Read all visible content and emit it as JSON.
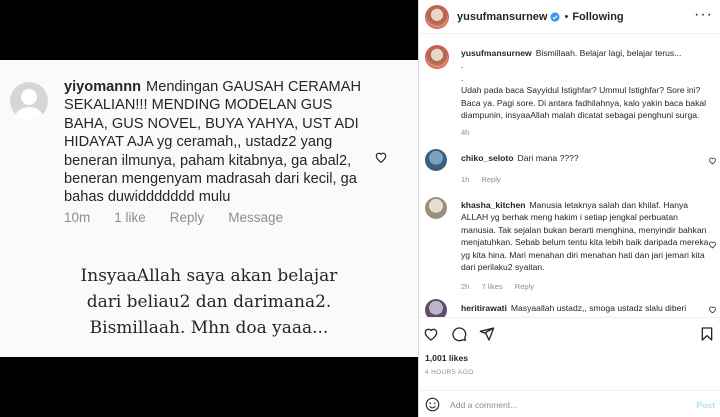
{
  "media": {
    "comment_user": "yiyomannn",
    "comment_text": "Mendingan GAUSAH CERAMAH SEKALIAN!!! MENDING MODELAN GUS BAHA, GUS NOVEL, BUYA YAHYA, UST ADI HIDAYAT AJA yg ceramah,, ustadz2 yang beneran ilmunya, paham kitabnya, ga abal2, beneran mengenyam madrasah dari kecil, ga bahas duwiddddddd mulu",
    "comment_time": "10m",
    "comment_likes": "1 like",
    "comment_reply": "Reply",
    "comment_message": "Message",
    "quote_lines": [
      "InsyaaAllah saya akan belajar",
      "dari beliau2 dan darimana2.",
      "Bismillaah. Mhn doa yaaa..."
    ]
  },
  "header": {
    "username": "yusufmansurnew",
    "separator": "•",
    "follow_label": "Following",
    "more_label": "···"
  },
  "caption": {
    "username": "yusufmansurnew",
    "line1": "Bismillaah. Belajar lagi, belajar terus...",
    "line2": ".",
    "line3": ".",
    "body": "Udah pada baca Sayyidul Istighfar? Ummul Istighfar? Sore ini? Baca ya. Pagi sore. Di antara fadhilahnya, kalo yakin baca bakal diampunin, insyaaAllah malah dicatat sebagai penghuni surga.",
    "time": "4h"
  },
  "comments": [
    {
      "username": "chiko_seloto",
      "text": "Dari mana ????",
      "time": "1h",
      "reply": "Reply",
      "likes": ""
    },
    {
      "username": "khasha_kitchen",
      "text": "Manusia letaknya salah dan khilaf. Hanya ALLAH yg berhak meng hakim i setiap jengkal perbuatan manusia. Tak sejalan bukan berarti menghina, menyindir bahkan menjatuhkan. Sebab belum tentu kita lebih baik daripada mereka yg kita hina. Mari menahan diri menahan hati dan jari jemari kita dari perilaku2 syaitan.",
      "time": "2h",
      "likes": "7 likes",
      "reply": "Reply"
    },
    {
      "username": "heritirawati",
      "text": "Masyaallah ustadz,, smoga ustadz slalu diberi",
      "time": "",
      "likes": "",
      "reply": ""
    }
  ],
  "footer": {
    "likes": "1,001 likes",
    "time_ago": "4 HOURS AGO",
    "comment_placeholder": "Add a comment...",
    "post_label": "Post"
  },
  "colors": {
    "verified": "#3897f0",
    "link_disabled": "#b2dffc",
    "muted": "#8e8e8e"
  },
  "icons": [
    "heart-icon",
    "comment-icon",
    "share-icon",
    "save-icon",
    "emoji-icon",
    "verified-icon",
    "more-icon"
  ]
}
